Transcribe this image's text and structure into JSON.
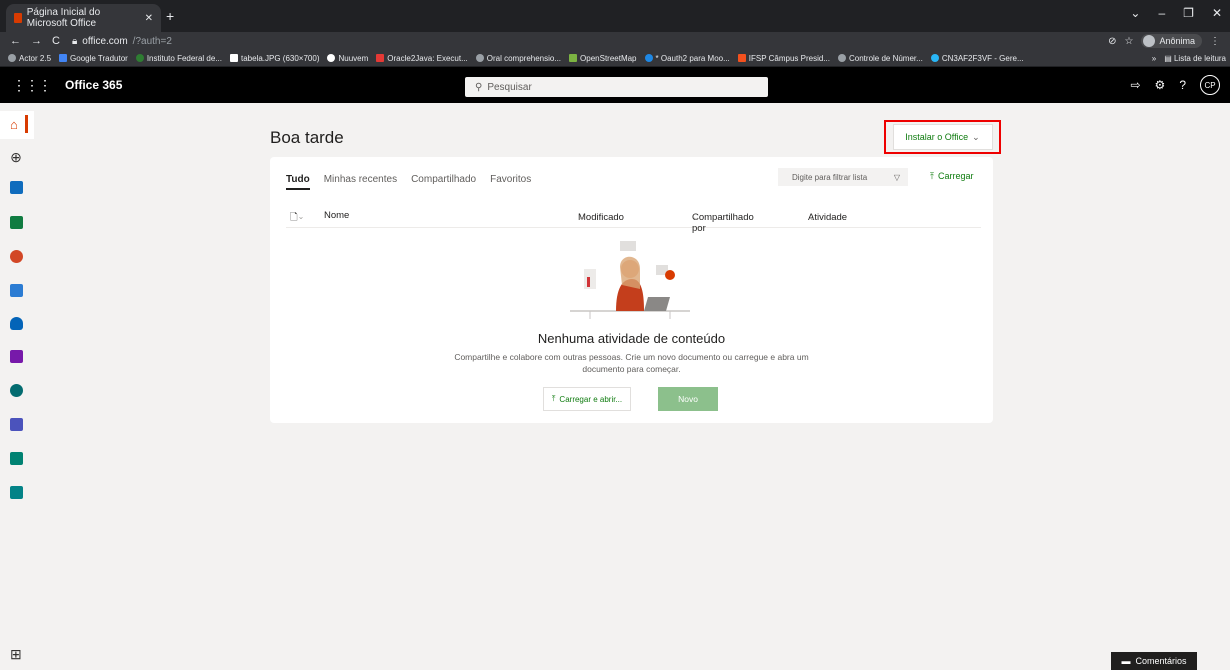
{
  "browser": {
    "tab_title": "Página Inicial do Microsoft Office",
    "url_host": "office.com",
    "url_path": "/?auth=2",
    "profile_label": "Anônima",
    "bookmarks": [
      "Actor 2.5",
      "Google Tradutor",
      "Instituto Federal de...",
      "tabela.JPG (630×700)",
      "Nuuvem",
      "Oracle2Java: Execut...",
      "Oral comprehensio...",
      "OpenStreetMap",
      "* Oauth2 para Moo...",
      "IFSP Câmpus Presid...",
      "Controle de Númer...",
      "CN3AF2F3VF - Gere..."
    ],
    "reading_list": "Lista de leitura"
  },
  "office": {
    "app_title": "Office 365",
    "search_placeholder": "Pesquisar",
    "avatar_initials": "CP"
  },
  "rail_apps": [
    {
      "name": "outlook",
      "color": "#0f6cbd"
    },
    {
      "name": "excel",
      "color": "#107c41"
    },
    {
      "name": "powerpoint",
      "color": "#d24726"
    },
    {
      "name": "onedrive-outlook",
      "color": "#2b7cd3"
    },
    {
      "name": "onedrive",
      "color": "#0364b8"
    },
    {
      "name": "onenote",
      "color": "#7719aa"
    },
    {
      "name": "sharepoint",
      "color": "#036c70"
    },
    {
      "name": "teams",
      "color": "#4b53bc"
    },
    {
      "name": "sway",
      "color": "#008272"
    },
    {
      "name": "forms",
      "color": "#038387"
    }
  ],
  "main": {
    "greeting": "Boa tarde",
    "install_office": "Instalar o Office",
    "tabs": [
      "Tudo",
      "Minhas recentes",
      "Compartilhado",
      "Favoritos"
    ],
    "filter_placeholder": "Digite para filtrar lista",
    "upload_label": "Carregar",
    "columns": {
      "name": "Nome",
      "modified": "Modificado",
      "shared_by": "Compartilhado por",
      "activity": "Atividade"
    },
    "empty_title": "Nenhuma atividade de conteúdo",
    "empty_desc": "Compartilhe e colabore com outras pessoas. Crie um novo documento ou carregue e abra um documento para começar.",
    "upload_open": "Carregar e abrir...",
    "new_button": "Novo"
  },
  "feedback": "Comentários",
  "colors": {
    "accent_green": "#107c10",
    "highlight_red": "#e00000"
  }
}
